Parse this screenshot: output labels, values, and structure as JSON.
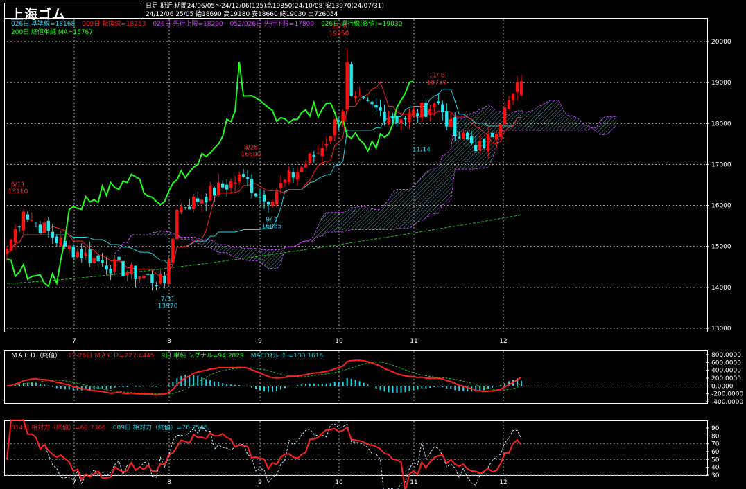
{
  "app": {
    "title": "上海ゴム",
    "header_line1": "日足  期近  期間24/06/05～24/12/06(125)高19850(24/10/08)安13970(24/07/31)",
    "header_line2": "24/12/06 25/05 始18690 高19180 安18660 終19030 出726054"
  },
  "legends": {
    "price": [
      {
        "text": "026日 基準線=18168",
        "color": "#22d3e8"
      },
      {
        "text": "009日 転換線=18253",
        "color": "#ff2020"
      },
      {
        "text": "026日 先行上限=18290",
        "color": "#d040ff"
      },
      {
        "text": "052/026日 先行下限=17800",
        "color": "#d040ff"
      },
      {
        "text": "026日 遅行線(終値)=19030",
        "color": "#20ff20"
      }
    ],
    "price_line2": [
      {
        "text": "200日 終値単純 MA=15767",
        "color": "#20ff20"
      }
    ],
    "macd": [
      {
        "text": "ＭＡＣＤ（終値）",
        "color": "#ffffff"
      },
      {
        "text": "12-26日 ＭＡＣＤ=227.4445",
        "color": "#ff2020"
      },
      {
        "text": "9日 単純 シグナル=94.2829",
        "color": "#20ff20"
      },
      {
        "text": "MACDｵｼﾚｰﾀｰ=133.1616",
        "color": "#22d3e8"
      }
    ],
    "rsi": [
      {
        "text": "014日 相対力（終値）=68.7366",
        "color": "#ff2020"
      },
      {
        "text": "009日 相対力（終値）=76.2546",
        "color": "#22d3e8"
      }
    ]
  },
  "axes": {
    "price_ticks": [
      "20000",
      "19000",
      "18000",
      "17000",
      "16000",
      "15000",
      "14000",
      "13000"
    ],
    "macd_ticks": [
      "800.0000",
      "600.0000",
      "400.0000",
      "200.0000",
      "0.0000",
      "-200.0000",
      "-400.0000"
    ],
    "rsi_ticks": [
      "90",
      "80",
      "70",
      "60",
      "50",
      "40",
      "30"
    ],
    "month_ticks": [
      "7",
      "8",
      "9",
      "10",
      "11",
      "12"
    ]
  },
  "annotations": [
    {
      "date": "6/11",
      "value": "13110",
      "color": "#ff3030"
    },
    {
      "date": "7/31",
      "value": "13970",
      "color": "#22d3e8"
    },
    {
      "date": "8/28",
      "value": "16800",
      "color": "#ff3030"
    },
    {
      "date": "9/ 4",
      "value": "16085",
      "color": "#22d3e8"
    },
    {
      "date": "10/ 8",
      "value": "19850",
      "color": "#ff3030"
    },
    {
      "date": "11/ 8",
      "value": "18730",
      "color": "#ff3030"
    },
    {
      "date": "11/14",
      "value": "",
      "color": "#22d3e8"
    }
  ],
  "colors": {
    "up": "#ff1010",
    "down": "#22e8f0",
    "kijun": "#22d3e8",
    "tenkan": "#ff2020",
    "cloud": "#d040ff",
    "chikou": "#20ff20",
    "ma200": "#20c020",
    "macd": "#ff2020",
    "signal": "#20c020",
    "osc": "#22d3e8",
    "rsi14": "#ff2020",
    "rsi9": "#c8e8ff"
  },
  "chart_data": [
    {
      "type": "candlestick",
      "title": "上海ゴム",
      "ylim": [
        13000,
        20200
      ],
      "monthly_points": {
        "x": [
          "6/05",
          "6/11",
          "6/25",
          "7/10",
          "7/31",
          "8/05",
          "8/28",
          "9/04",
          "9/24",
          "10/08",
          "10/25",
          "11/08",
          "11/14",
          "11/25",
          "12/06"
        ],
        "close": [
          14950,
          15850,
          15000,
          14600,
          14100,
          15900,
          16700,
          16100,
          17400,
          18600,
          18100,
          18500,
          17700,
          17400,
          19030
        ]
      },
      "high": 19850,
      "low": 13970,
      "last": {
        "open": 18690,
        "high": 19180,
        "low": 18660,
        "close": 19030
      },
      "kijun_26": 18168,
      "tenkan_9": 18253,
      "senkou_a": 18290,
      "senkou_b": 17800,
      "chikou": 19030,
      "ma200": 15767
    },
    {
      "type": "line",
      "title": "ＭＡＣＤ（終値）",
      "ylim": [
        -400,
        800
      ],
      "series": [
        {
          "name": "12-26日 ＭＡＣＤ",
          "last": 227.4445
        },
        {
          "name": "9日 単純 シグナル",
          "last": 94.2829
        },
        {
          "name": "MACDｵｼﾚｰﾀｰ",
          "last": 133.1616
        }
      ]
    },
    {
      "type": "line",
      "title": "相対力（終値）",
      "ylim": [
        30,
        90
      ],
      "series": [
        {
          "name": "014日 相対力（終値）",
          "last": 68.7366
        },
        {
          "name": "009日 相対力（終値）",
          "last": 76.2546
        }
      ]
    }
  ]
}
